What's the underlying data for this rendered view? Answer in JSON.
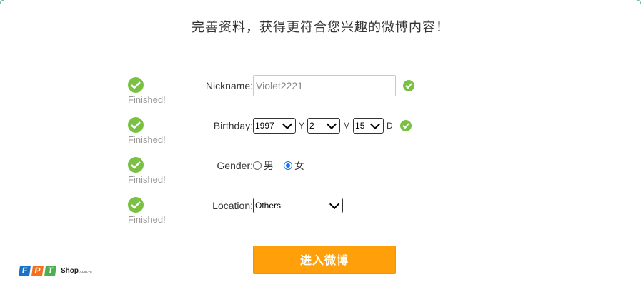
{
  "headline": "完善资料，获得更符合您兴趣的微博内容！",
  "status_text": "Finished!",
  "nickname": {
    "label": "Nickname:",
    "value": "Violet2221"
  },
  "birthday": {
    "label": "Birthday:",
    "year": "1997",
    "year_unit": "Y",
    "month": "2",
    "month_unit": "M",
    "day": "15",
    "day_unit": "D"
  },
  "gender": {
    "label": "Gender:",
    "options": [
      "男",
      "女"
    ],
    "selected": "女"
  },
  "location": {
    "label": "Location:",
    "value": "Others"
  },
  "submit_label": "进入微博",
  "logo": {
    "letters": [
      "F",
      "P",
      "T"
    ],
    "shop": "Shop",
    "domain": ".com.vn"
  },
  "colors": {
    "accent": "#ffa00a",
    "check": "#7ac143",
    "radio": "#1a73e8",
    "logo_f": "#1a73c8",
    "logo_p": "#f37021",
    "logo_t": "#4caf50"
  }
}
